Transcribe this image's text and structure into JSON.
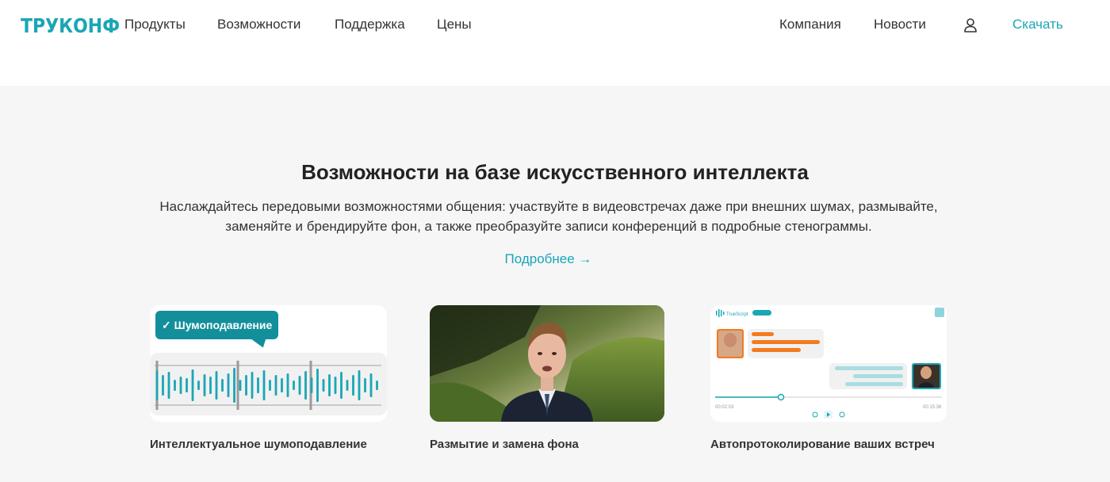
{
  "header": {
    "logo_text": "ТРУКОНФ",
    "nav_left": [
      "Продукты",
      "Возможности",
      "Поддержка",
      "Цены"
    ],
    "nav_right": [
      "Компания",
      "Новости"
    ],
    "user_icon": "user-icon",
    "download_label": "Скачать"
  },
  "section": {
    "title": "Возможности на базе искусственного интеллекта",
    "subtitle": "Наслаждайтесь передовыми возможностями общения: участвуйте в видеовстречах даже при внешних шумах, размывайте, заменяйте и брендируйте фон, а также преобразуйте записи конференций в подробные стенограммы.",
    "more_label": "Подробнее →"
  },
  "cards": [
    {
      "caption": "Интеллектуальное шумоподавление",
      "badge": "✓ Шумоподавление"
    },
    {
      "caption": "Размытие и замена фона"
    },
    {
      "caption": "Автопротоколирование ваших встреч",
      "app_name": "TrueScript",
      "time_start": "00:02:03",
      "time_end": "00:15:36"
    }
  ],
  "colors": {
    "accent": "#1aa6b5",
    "badge": "#138f9c",
    "orange": "#f47a20"
  }
}
